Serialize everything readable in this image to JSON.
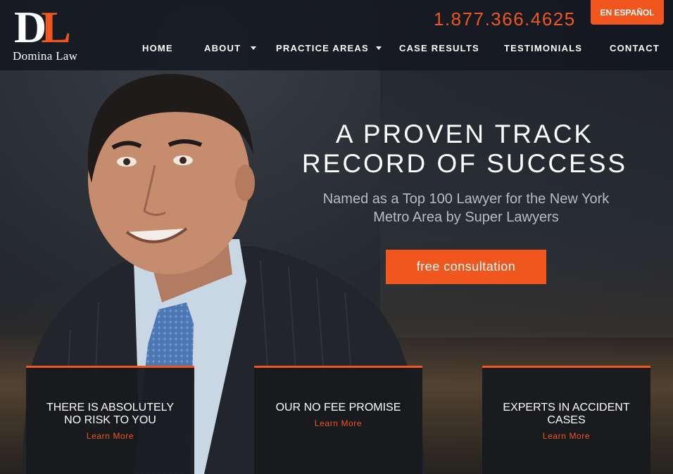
{
  "brand": {
    "logo_letters": "DL",
    "logo_name": "Domina Law",
    "accent_color": "#f0561d"
  },
  "header": {
    "phone": "1.877.366.4625",
    "language_button": "EN ESPAÑOL"
  },
  "nav": {
    "items": [
      {
        "label": "HOME",
        "has_dropdown": false
      },
      {
        "label": "ABOUT",
        "has_dropdown": true
      },
      {
        "label": "PRACTICE AREAS",
        "has_dropdown": true
      },
      {
        "label": "CASE RESULTS",
        "has_dropdown": false
      },
      {
        "label": "TESTIMONIALS",
        "has_dropdown": false
      },
      {
        "label": "CONTACT",
        "has_dropdown": false
      }
    ]
  },
  "hero": {
    "headline_line1": "A PROVEN TRACK",
    "headline_line2": "RECORD OF SUCCESS",
    "subhead_line1": "Named as a Top 100 Lawyer for the New York",
    "subhead_line2": "Metro Area by Super Lawyers",
    "cta_label": "free consultation"
  },
  "cards": [
    {
      "title_line1": "THERE IS ABSOLUTELY",
      "title_line2": "NO RISK TO YOU",
      "link": "Learn More"
    },
    {
      "title_line1": "OUR NO FEE PROMISE",
      "title_line2": "",
      "link": "Learn More"
    },
    {
      "title_line1": "EXPERTS IN ACCIDENT",
      "title_line2": "CASES",
      "link": "Learn More"
    }
  ]
}
